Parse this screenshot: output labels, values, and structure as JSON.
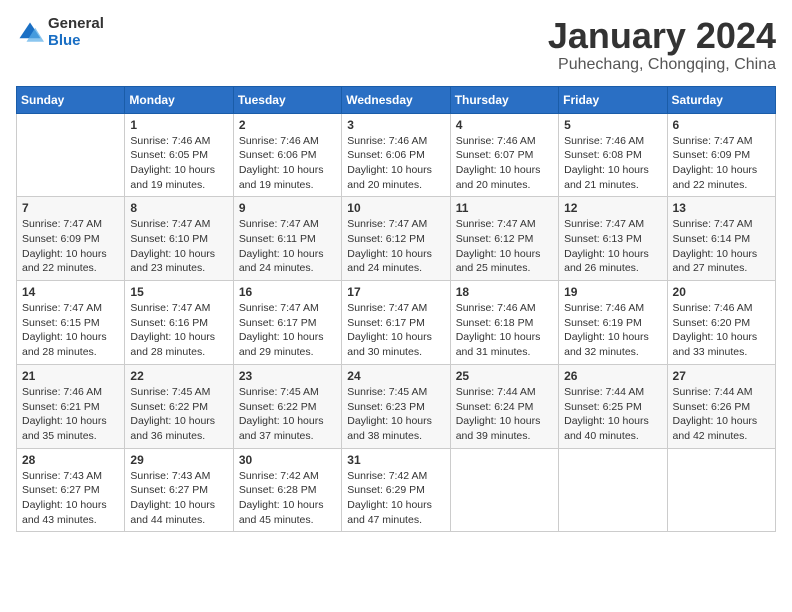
{
  "logo": {
    "general": "General",
    "blue": "Blue"
  },
  "title": {
    "month_year": "January 2024",
    "location": "Puhechang, Chongqing, China"
  },
  "weekdays": [
    "Sunday",
    "Monday",
    "Tuesday",
    "Wednesday",
    "Thursday",
    "Friday",
    "Saturday"
  ],
  "weeks": [
    [
      {
        "day": null
      },
      {
        "day": "1",
        "sunrise": "7:46 AM",
        "sunset": "6:05 PM",
        "daylight": "10 hours and 19 minutes."
      },
      {
        "day": "2",
        "sunrise": "7:46 AM",
        "sunset": "6:06 PM",
        "daylight": "10 hours and 19 minutes."
      },
      {
        "day": "3",
        "sunrise": "7:46 AM",
        "sunset": "6:06 PM",
        "daylight": "10 hours and 20 minutes."
      },
      {
        "day": "4",
        "sunrise": "7:46 AM",
        "sunset": "6:07 PM",
        "daylight": "10 hours and 20 minutes."
      },
      {
        "day": "5",
        "sunrise": "7:46 AM",
        "sunset": "6:08 PM",
        "daylight": "10 hours and 21 minutes."
      },
      {
        "day": "6",
        "sunrise": "7:47 AM",
        "sunset": "6:09 PM",
        "daylight": "10 hours and 22 minutes."
      }
    ],
    [
      {
        "day": "7",
        "sunrise": "7:47 AM",
        "sunset": "6:09 PM",
        "daylight": "10 hours and 22 minutes."
      },
      {
        "day": "8",
        "sunrise": "7:47 AM",
        "sunset": "6:10 PM",
        "daylight": "10 hours and 23 minutes."
      },
      {
        "day": "9",
        "sunrise": "7:47 AM",
        "sunset": "6:11 PM",
        "daylight": "10 hours and 24 minutes."
      },
      {
        "day": "10",
        "sunrise": "7:47 AM",
        "sunset": "6:12 PM",
        "daylight": "10 hours and 24 minutes."
      },
      {
        "day": "11",
        "sunrise": "7:47 AM",
        "sunset": "6:12 PM",
        "daylight": "10 hours and 25 minutes."
      },
      {
        "day": "12",
        "sunrise": "7:47 AM",
        "sunset": "6:13 PM",
        "daylight": "10 hours and 26 minutes."
      },
      {
        "day": "13",
        "sunrise": "7:47 AM",
        "sunset": "6:14 PM",
        "daylight": "10 hours and 27 minutes."
      }
    ],
    [
      {
        "day": "14",
        "sunrise": "7:47 AM",
        "sunset": "6:15 PM",
        "daylight": "10 hours and 28 minutes."
      },
      {
        "day": "15",
        "sunrise": "7:47 AM",
        "sunset": "6:16 PM",
        "daylight": "10 hours and 28 minutes."
      },
      {
        "day": "16",
        "sunrise": "7:47 AM",
        "sunset": "6:17 PM",
        "daylight": "10 hours and 29 minutes."
      },
      {
        "day": "17",
        "sunrise": "7:47 AM",
        "sunset": "6:17 PM",
        "daylight": "10 hours and 30 minutes."
      },
      {
        "day": "18",
        "sunrise": "7:46 AM",
        "sunset": "6:18 PM",
        "daylight": "10 hours and 31 minutes."
      },
      {
        "day": "19",
        "sunrise": "7:46 AM",
        "sunset": "6:19 PM",
        "daylight": "10 hours and 32 minutes."
      },
      {
        "day": "20",
        "sunrise": "7:46 AM",
        "sunset": "6:20 PM",
        "daylight": "10 hours and 33 minutes."
      }
    ],
    [
      {
        "day": "21",
        "sunrise": "7:46 AM",
        "sunset": "6:21 PM",
        "daylight": "10 hours and 35 minutes."
      },
      {
        "day": "22",
        "sunrise": "7:45 AM",
        "sunset": "6:22 PM",
        "daylight": "10 hours and 36 minutes."
      },
      {
        "day": "23",
        "sunrise": "7:45 AM",
        "sunset": "6:22 PM",
        "daylight": "10 hours and 37 minutes."
      },
      {
        "day": "24",
        "sunrise": "7:45 AM",
        "sunset": "6:23 PM",
        "daylight": "10 hours and 38 minutes."
      },
      {
        "day": "25",
        "sunrise": "7:44 AM",
        "sunset": "6:24 PM",
        "daylight": "10 hours and 39 minutes."
      },
      {
        "day": "26",
        "sunrise": "7:44 AM",
        "sunset": "6:25 PM",
        "daylight": "10 hours and 40 minutes."
      },
      {
        "day": "27",
        "sunrise": "7:44 AM",
        "sunset": "6:26 PM",
        "daylight": "10 hours and 42 minutes."
      }
    ],
    [
      {
        "day": "28",
        "sunrise": "7:43 AM",
        "sunset": "6:27 PM",
        "daylight": "10 hours and 43 minutes."
      },
      {
        "day": "29",
        "sunrise": "7:43 AM",
        "sunset": "6:27 PM",
        "daylight": "10 hours and 44 minutes."
      },
      {
        "day": "30",
        "sunrise": "7:42 AM",
        "sunset": "6:28 PM",
        "daylight": "10 hours and 45 minutes."
      },
      {
        "day": "31",
        "sunrise": "7:42 AM",
        "sunset": "6:29 PM",
        "daylight": "10 hours and 47 minutes."
      },
      {
        "day": null
      },
      {
        "day": null
      },
      {
        "day": null
      }
    ]
  ],
  "labels": {
    "sunrise": "Sunrise:",
    "sunset": "Sunset:",
    "daylight": "Daylight:"
  }
}
